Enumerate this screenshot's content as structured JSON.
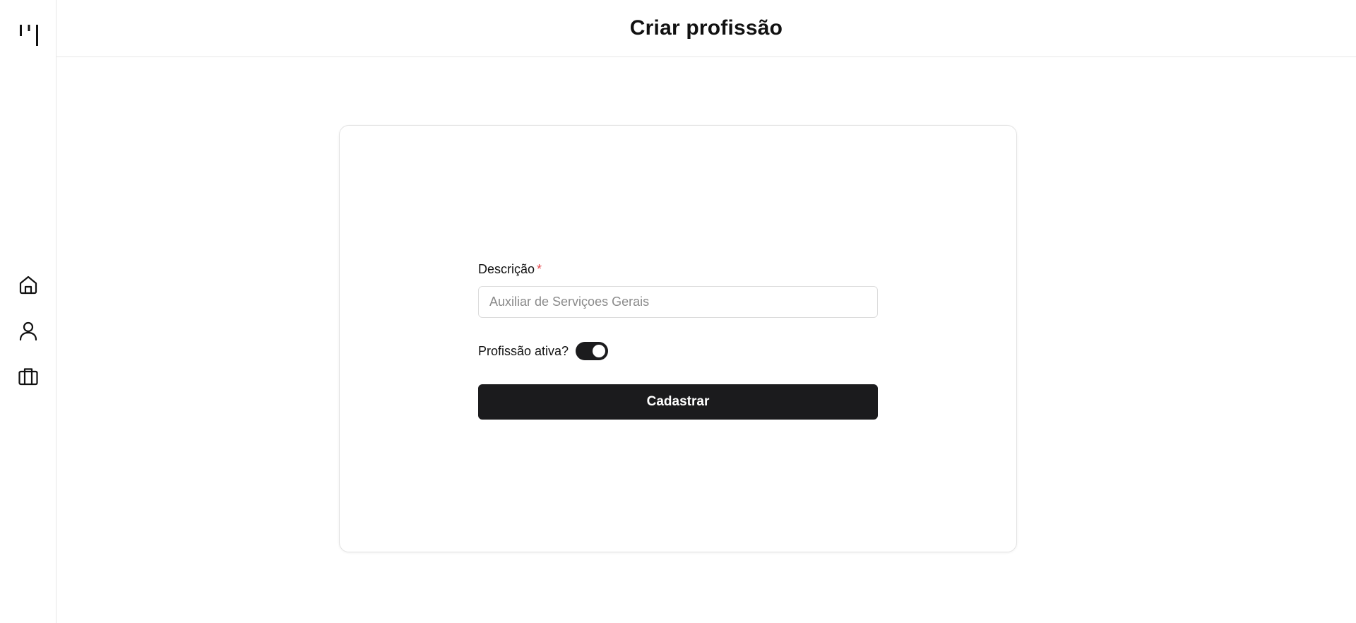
{
  "header": {
    "title": "Criar profissão"
  },
  "sidebar": {
    "logo_icon": "brand-logo-icon",
    "items": [
      {
        "icon": "home-icon"
      },
      {
        "icon": "user-icon"
      },
      {
        "icon": "briefcase-icon"
      }
    ]
  },
  "form": {
    "description_label": "Descrição",
    "required_marker": "*",
    "description_value": "",
    "description_placeholder": "Auxiliar de Serviçoes Gerais",
    "active_label": "Profissão ativa?",
    "active_toggle_on": true,
    "submit_label": "Cadastrar"
  },
  "colors": {
    "primary": "#1b1b1d",
    "required": "#e5484d",
    "border": "#e6e6e6"
  }
}
